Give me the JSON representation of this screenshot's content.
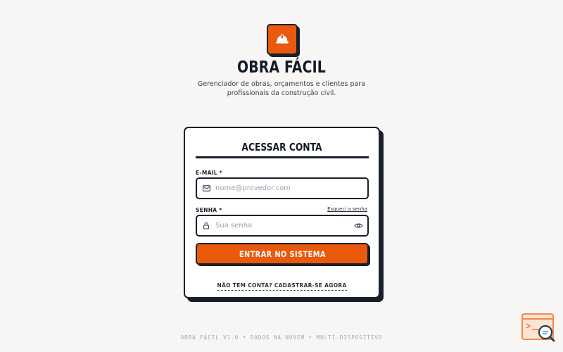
{
  "brand": {
    "title": "OBRA FÁCIL",
    "subtitle": "Gerenciador de obras, orçamentos e clientes para profissionais da construção civil.",
    "logo_icon": "hard-hat-icon",
    "accent_color": "#e95a0c"
  },
  "login": {
    "title": "ACESSAR CONTA",
    "email": {
      "label": "E-MAIL *",
      "placeholder": "nome@provedor.com",
      "value": "",
      "icon": "mail-icon"
    },
    "password": {
      "label": "SENHA *",
      "placeholder": "Sua senha",
      "value": "",
      "icon": "lock-icon",
      "toggle_icon": "eye-icon",
      "forgot_label": "Esqueci a senha"
    },
    "submit_label": "ENTRAR NO SISTEMA",
    "signup_label": "NÃO TEM CONTA? CADASTRAR-SE AGORA"
  },
  "footer": {
    "text": "OBRA FÁCIL V1.0 • DADOS NA NUVEM • MULTI-DISPOSITIVO"
  },
  "corner_badge": {
    "icon": "search-code-icon"
  }
}
